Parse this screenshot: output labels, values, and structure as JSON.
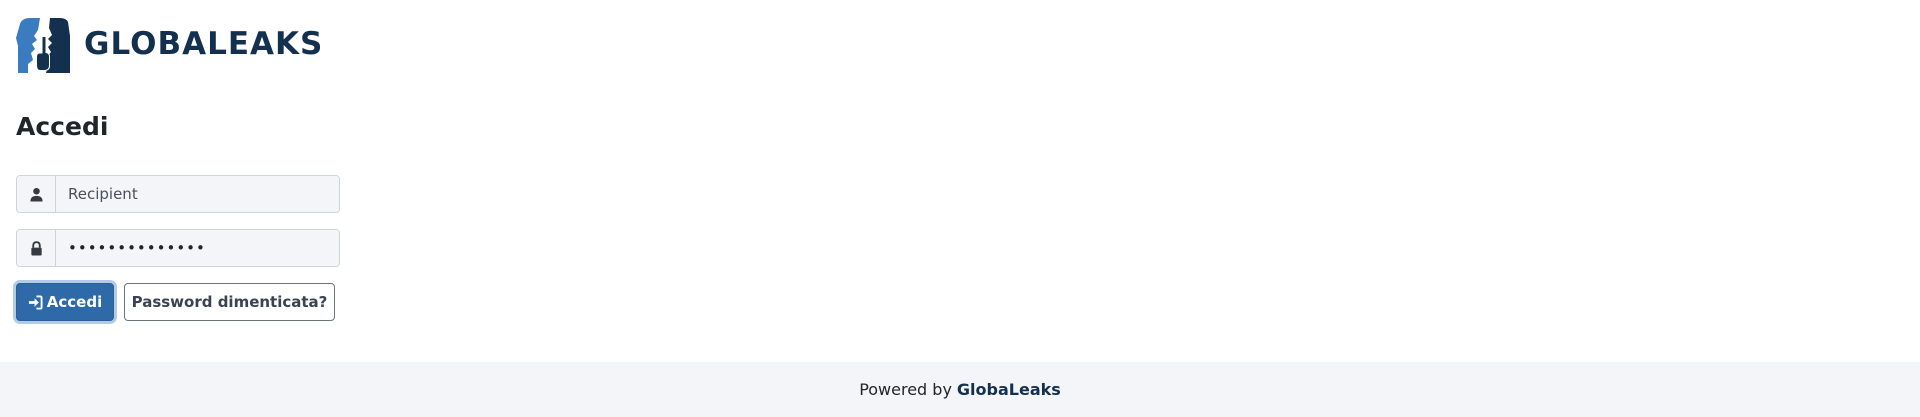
{
  "header": {
    "logo_text": "GLOBALEAKS",
    "logo_icon": "globaleaks-faces-logo"
  },
  "login": {
    "title": "Accedi",
    "username": {
      "icon": "user-icon",
      "value": "Recipient"
    },
    "password": {
      "icon": "lock-icon",
      "value": "••••••••••••••"
    },
    "submit_label": "Accedi",
    "submit_icon": "sign-in-icon",
    "forgot_label": "Password dimenticata?"
  },
  "footer": {
    "prefix": "Powered by",
    "brand": "GlobaLeaks"
  },
  "colors": {
    "brand_dark": "#14304f",
    "brand_blue": "#3b7bbf",
    "primary_button": "#2e6aa8",
    "input_bg": "#f4f5f8",
    "footer_bg": "#f4f5f8"
  }
}
